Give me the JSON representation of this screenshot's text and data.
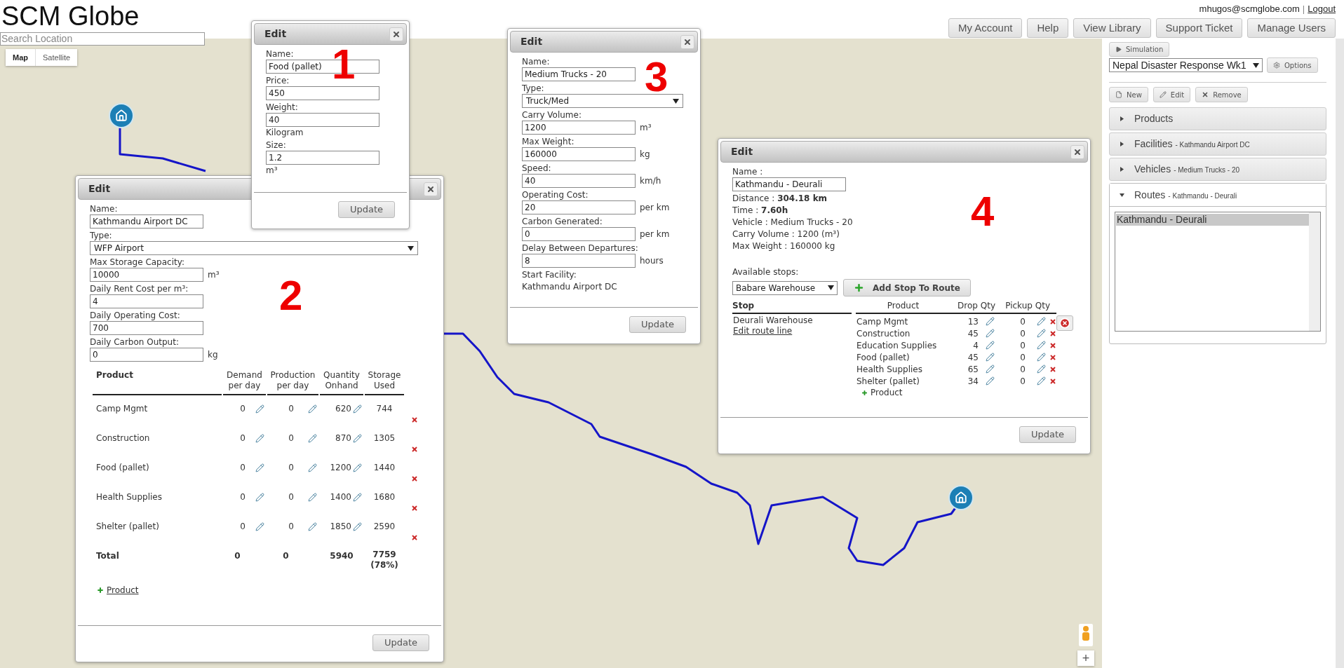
{
  "header": {
    "logo": "SCM Globe",
    "search": {
      "placeholder": "Search Location"
    },
    "user": {
      "email": "mhugos@scmglobe.com",
      "separator": "|",
      "logout": "Logout"
    },
    "nav_buttons": [
      "My Account",
      "Help",
      "View Library",
      "Support Ticket",
      "Manage Users"
    ]
  },
  "map": {
    "view_toggle": [
      {
        "label": "Map",
        "selected": true
      },
      {
        "label": "Satellite",
        "selected": false
      }
    ],
    "zoom_in": "+"
  },
  "dialogs": [
    {
      "kind": "product",
      "title": "Edit",
      "annotation": "1",
      "fields": [
        {
          "kind": "text",
          "label": "Name:",
          "value": "Food (pallet)"
        },
        {
          "kind": "text",
          "label": "Price:",
          "value": "450"
        },
        {
          "kind": "text",
          "label": "Weight:",
          "value": "40",
          "unit": "Kilogram"
        },
        {
          "kind": "text",
          "label": "Size:",
          "value": "1.2",
          "unit": "m³"
        }
      ],
      "update": "Update"
    },
    {
      "kind": "facility",
      "title": "Edit",
      "annotation": "2",
      "fields": [
        {
          "kind": "text",
          "label": "Name:",
          "value": "Kathmandu Airport DC"
        },
        {
          "kind": "select",
          "label": "Type:",
          "value": "WFP Airport"
        },
        {
          "kind": "text",
          "label": "Max Storage Capacity:",
          "value": "10000",
          "unit": "m³"
        },
        {
          "kind": "text",
          "label": "Daily Rent Cost per m³:",
          "value": "4"
        },
        {
          "kind": "text",
          "label": "Daily Operating Cost:",
          "value": "700"
        },
        {
          "kind": "text",
          "label": "Daily Carbon Output:",
          "value": "0",
          "unit": "kg"
        }
      ],
      "table": {
        "columns": [
          "Product",
          "Demand per day",
          "Production per day",
          "Quantity Onhand",
          "Storage Used"
        ],
        "rows": [
          {
            "product": "Camp Mgmt",
            "demand": "0",
            "production": "0",
            "onhand": "620",
            "storage": "744"
          },
          {
            "product": "Construction",
            "demand": "0",
            "production": "0",
            "onhand": "870",
            "storage": "1305"
          },
          {
            "product": "Food (pallet)",
            "demand": "0",
            "production": "0",
            "onhand": "1200",
            "storage": "1440"
          },
          {
            "product": "Health Supplies",
            "demand": "0",
            "production": "0",
            "onhand": "1400",
            "storage": "1680"
          },
          {
            "product": "Shelter (pallet)",
            "demand": "0",
            "production": "0",
            "onhand": "1850",
            "storage": "2590"
          }
        ],
        "total": {
          "label": "Total",
          "demand": "0",
          "production": "0",
          "onhand": "5940",
          "storage": "7759 (78%)"
        }
      },
      "add_product": "Product",
      "update": "Update"
    },
    {
      "kind": "vehicle",
      "title": "Edit",
      "annotation": "3",
      "fields": [
        {
          "kind": "text",
          "label": "Name:",
          "value": "Medium Trucks - 20"
        },
        {
          "kind": "select",
          "label": "Type:",
          "value": "Truck/Med"
        },
        {
          "kind": "text",
          "label": "Carry Volume:",
          "value": "1200",
          "unit": "m³"
        },
        {
          "kind": "text",
          "label": "Max Weight:",
          "value": "160000",
          "unit": "kg"
        },
        {
          "kind": "text",
          "label": "Speed:",
          "value": "40",
          "unit": "km/h"
        },
        {
          "kind": "text",
          "label": "Operating Cost:",
          "value": "20",
          "unit": "per km"
        },
        {
          "kind": "text",
          "label": "Carbon Generated:",
          "value": "0",
          "unit": "per km"
        },
        {
          "kind": "text",
          "label": "Delay Between Departures:",
          "value": "8",
          "unit": "hours"
        },
        {
          "kind": "static",
          "label": "Start Facility:",
          "value": "Kathmandu Airport DC"
        }
      ],
      "update": "Update"
    },
    {
      "kind": "route",
      "title": "Edit",
      "annotation": "4",
      "fields": [
        {
          "kind": "text",
          "label": "Name :",
          "value": "Kathmandu - Deurali"
        }
      ],
      "info": [
        "Distance : **304.18 km**",
        "Time : **7.60h**",
        "Vehicle : Medium Trucks - 20",
        "Carry Volume : 1200 (m³)",
        "Max Weight : 160000 kg"
      ],
      "stops_label": "Available stops:",
      "stop_select": "Babare Warehouse",
      "add_stop": "Add Stop To Route",
      "stops_table": {
        "columns": [
          "Stop",
          "Product",
          "Drop Qty",
          "Pickup Qty"
        ],
        "stops": [
          {
            "name": "Deurali Warehouse",
            "edit_link": "Edit route line",
            "products": [
              {
                "name": "Camp Mgmt",
                "drop": "13",
                "pickup": "0"
              },
              {
                "name": "Construction",
                "drop": "45",
                "pickup": "0"
              },
              {
                "name": "Education Supplies",
                "drop": "4",
                "pickup": "0"
              },
              {
                "name": "Food (pallet)",
                "drop": "45",
                "pickup": "0"
              },
              {
                "name": "Health Supplies",
                "drop": "65",
                "pickup": "0"
              },
              {
                "name": "Shelter (pallet)",
                "drop": "34",
                "pickup": "0"
              }
            ],
            "add_product": "Product"
          }
        ]
      },
      "update": "Update"
    }
  ],
  "sidebar": {
    "simulation": "Simulation",
    "scenario": "Nepal Disaster Response Wk1",
    "options": "Options",
    "actions": [
      "New",
      "Edit",
      "Remove"
    ],
    "sections": [
      {
        "title": "Products",
        "expanded": false
      },
      {
        "title": "Facilities",
        "subtitle": "- Kathmandu Airport DC",
        "expanded": false
      },
      {
        "title": "Vehicles",
        "subtitle": "- Medium Trucks - 20",
        "expanded": false
      },
      {
        "title": "Routes",
        "subtitle": "- Kathmandu - Deurali",
        "expanded": true,
        "items": [
          {
            "label": "Kathmandu - Deurali",
            "selected": true
          }
        ]
      }
    ]
  }
}
